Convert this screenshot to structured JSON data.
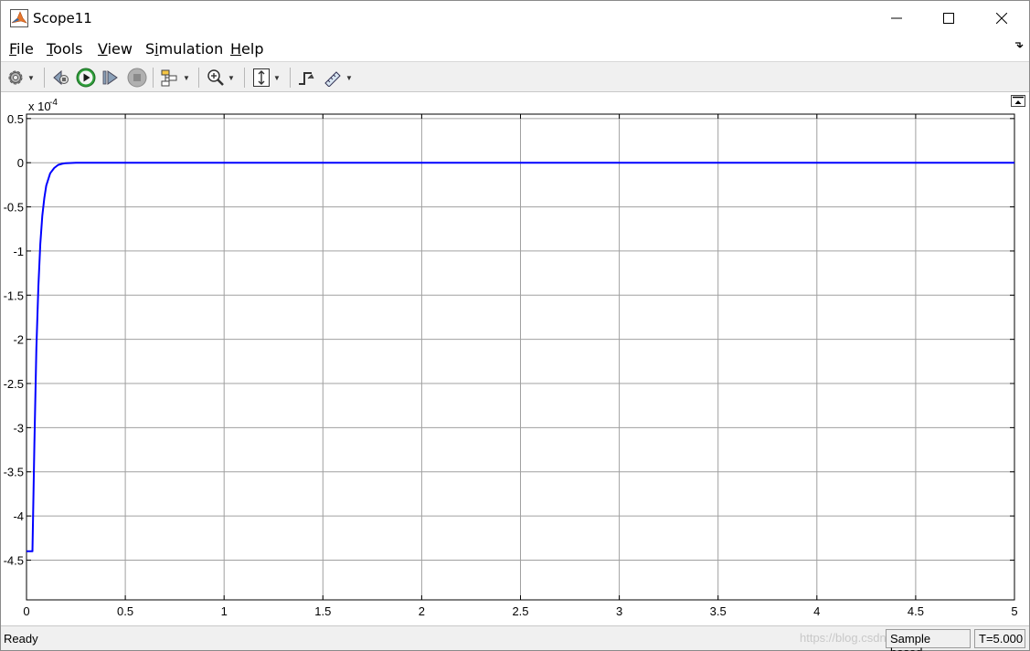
{
  "window": {
    "title": "Scope11",
    "icon": "matlab-icon",
    "controls": [
      "minimize-icon",
      "maximize-icon",
      "close-icon"
    ]
  },
  "menu": {
    "items": [
      {
        "label": "File",
        "mnemonic": "F",
        "rest": "ile"
      },
      {
        "label": "Tools",
        "mnemonic": "T",
        "rest": "ools"
      },
      {
        "label": "View",
        "mnemonic": "V",
        "rest": "iew"
      },
      {
        "label": "Simulation",
        "pre": "S",
        "mnemonic": "i",
        "rest": "mulation"
      },
      {
        "label": "Help",
        "mnemonic": "H",
        "rest": "elp"
      }
    ]
  },
  "toolbar": {
    "icons": [
      "gear-icon",
      "step-back-icon",
      "run-icon",
      "step-forward-icon",
      "stop-icon",
      "highlight-model-icon",
      "zoom-in-icon",
      "scale-axes-icon",
      "trigger-icon",
      "measurements-icon"
    ]
  },
  "chart_data": {
    "type": "line",
    "title": "",
    "xlabel": "",
    "ylabel": "",
    "y_exponent_label": "x 10",
    "y_exponent": "-4",
    "xlim": [
      0,
      5
    ],
    "ylim": [
      -4.95,
      0.55
    ],
    "x_ticks": [
      0,
      0.5,
      1,
      1.5,
      2,
      2.5,
      3,
      3.5,
      4,
      4.5,
      5
    ],
    "x_tick_labels": [
      "0",
      "0.5",
      "1",
      "1.5",
      "2",
      "2.5",
      "3",
      "3.5",
      "4",
      "4.5",
      "5"
    ],
    "y_ticks": [
      0.5,
      0,
      -0.5,
      -1,
      -1.5,
      -2,
      -2.5,
      -3,
      -3.5,
      -4,
      -4.5
    ],
    "y_tick_labels": [
      "0.5",
      "0",
      "-0.5",
      "-1",
      "-1.5",
      "-2",
      "-2.5",
      "-3",
      "-3.5",
      "-4",
      "-4.5"
    ],
    "grid": true,
    "line_color": "#0000ff",
    "series": [
      {
        "x": [
          0,
          0.03,
          0.04,
          0.05,
          0.06,
          0.07,
          0.08,
          0.09,
          0.1,
          0.12,
          0.14,
          0.16,
          0.18,
          0.2,
          0.25,
          0.3,
          0.5,
          1,
          2,
          3,
          4,
          5
        ],
        "y": [
          -4.4,
          -4.4,
          -3.2,
          -2.1,
          -1.4,
          -0.92,
          -0.6,
          -0.4,
          -0.26,
          -0.12,
          -0.06,
          -0.025,
          -0.012,
          -0.005,
          0,
          0,
          0,
          0,
          0,
          0,
          0,
          0
        ]
      }
    ]
  },
  "status": {
    "ready": "Ready",
    "sample_mode": "Sample based",
    "time": "T=5.000",
    "watermark": "https://blog.csdn.net/"
  },
  "colors": {
    "toolbar_bg": "#f0f0f0",
    "grid": "#a0a0a0",
    "trace": "#0000ff"
  }
}
